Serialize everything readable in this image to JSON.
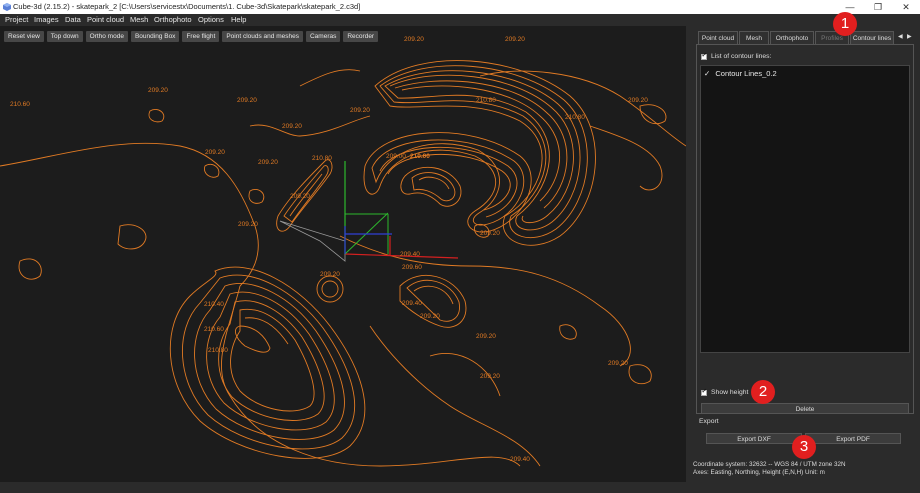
{
  "titlebar": {
    "title": "Cube-3d (2.15.2) - skatepark_2 [C:\\Users\\servicestx\\Documents\\1. Cube-3d\\Skatepark\\skatepark_2.c3d]",
    "minimize": "—",
    "restore": "❐",
    "close": "✕"
  },
  "menu": [
    "Project",
    "Images",
    "Data",
    "Point cloud",
    "Mesh",
    "Orthophoto",
    "Options",
    "Help"
  ],
  "toolbar": [
    "Reset view",
    "Top down",
    "Ortho mode",
    "Bounding Box",
    "Free flight",
    "Point clouds and meshes",
    "Cameras",
    "Recorder"
  ],
  "viewport": {
    "colors": {
      "contour": "#e07a24",
      "background": "#1c1c1c",
      "axis_x": "#d42020",
      "axis_y": "#2db82d",
      "axis_z": "#2f3fd6"
    },
    "labels": [
      {
        "text": "210.60"
      },
      {
        "text": "209.20"
      },
      {
        "text": "209.20"
      },
      {
        "text": "209.20"
      },
      {
        "text": "209.20"
      },
      {
        "text": "209.20"
      },
      {
        "text": "209.20"
      },
      {
        "text": "209.20"
      },
      {
        "text": "209.20"
      },
      {
        "text": "210.80"
      },
      {
        "text": "209.00"
      },
      {
        "text": "210.00"
      },
      {
        "text": "210.80"
      },
      {
        "text": "209.20"
      },
      {
        "text": "209.20"
      },
      {
        "text": "210.80"
      },
      {
        "text": "209.20"
      },
      {
        "text": "209.40"
      },
      {
        "text": "209.60"
      },
      {
        "text": "209.40"
      },
      {
        "text": "210.40"
      },
      {
        "text": "210.60"
      },
      {
        "text": "210.80"
      },
      {
        "text": "209.20"
      },
      {
        "text": "209.20"
      },
      {
        "text": "209.40"
      },
      {
        "text": "209.20"
      },
      {
        "text": "209.20"
      },
      {
        "text": "209.20"
      },
      {
        "text": "209.20"
      }
    ]
  },
  "panel": {
    "tabs": [
      "Point cloud",
      "Mesh",
      "Orthophoto",
      "Profiles",
      "Contour lines"
    ],
    "tab_arrows": [
      "◀",
      "▶"
    ],
    "list_checkbox_label": "List of contour lines:",
    "list_items": [
      "Contour Lines_0.2"
    ],
    "show_height_label": "Show height",
    "delete_button": "Delete",
    "export_header": "Export",
    "export_dxf": "Export DXF",
    "export_pdf": "Export PDF",
    "coord_system": "Coordinate system: 32632 -- WGS 84 / UTM zone 32N",
    "axes": "Axes: Easting, Northing, Height (E,N,H) Unit: m"
  },
  "badges": [
    "1",
    "2",
    "3"
  ]
}
